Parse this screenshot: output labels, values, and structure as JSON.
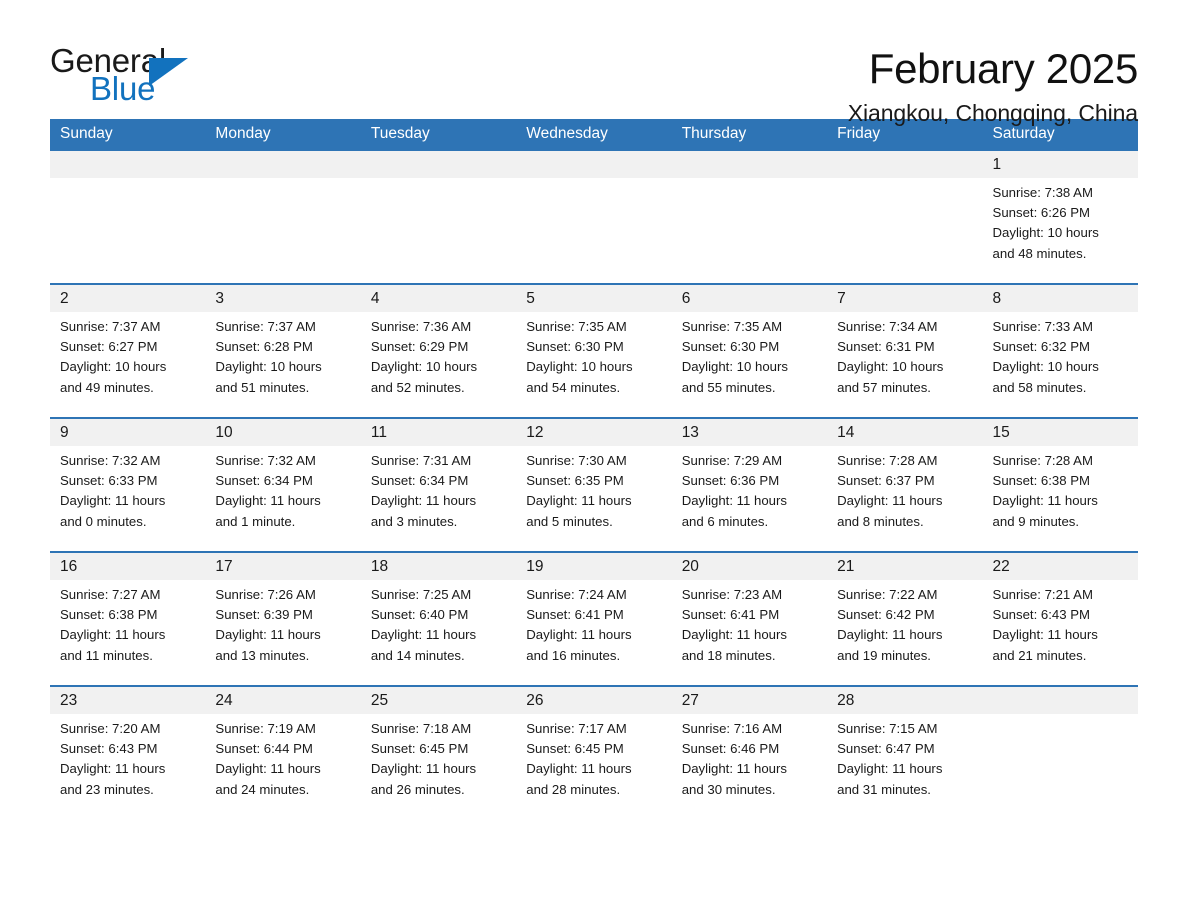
{
  "brand": {
    "word_one": "General",
    "word_two": "Blue",
    "triangle_icon": "triangle-icon",
    "accent_color": "#1272be"
  },
  "header": {
    "title": "February 2025",
    "location": "Xiangkou, Chongqing, China"
  },
  "calendar": {
    "header_color": "#2e74b5",
    "daynum_band_color": "#f1f1f1",
    "weekday_headers": [
      "Sunday",
      "Monday",
      "Tuesday",
      "Wednesday",
      "Thursday",
      "Friday",
      "Saturday"
    ],
    "weeks": [
      [
        {
          "day": "",
          "lines": []
        },
        {
          "day": "",
          "lines": []
        },
        {
          "day": "",
          "lines": []
        },
        {
          "day": "",
          "lines": []
        },
        {
          "day": "",
          "lines": []
        },
        {
          "day": "",
          "lines": []
        },
        {
          "day": "1",
          "lines": [
            "Sunrise: 7:38 AM",
            "Sunset: 6:26 PM",
            "Daylight: 10 hours",
            "and 48 minutes."
          ]
        }
      ],
      [
        {
          "day": "2",
          "lines": [
            "Sunrise: 7:37 AM",
            "Sunset: 6:27 PM",
            "Daylight: 10 hours",
            "and 49 minutes."
          ]
        },
        {
          "day": "3",
          "lines": [
            "Sunrise: 7:37 AM",
            "Sunset: 6:28 PM",
            "Daylight: 10 hours",
            "and 51 minutes."
          ]
        },
        {
          "day": "4",
          "lines": [
            "Sunrise: 7:36 AM",
            "Sunset: 6:29 PM",
            "Daylight: 10 hours",
            "and 52 minutes."
          ]
        },
        {
          "day": "5",
          "lines": [
            "Sunrise: 7:35 AM",
            "Sunset: 6:30 PM",
            "Daylight: 10 hours",
            "and 54 minutes."
          ]
        },
        {
          "day": "6",
          "lines": [
            "Sunrise: 7:35 AM",
            "Sunset: 6:30 PM",
            "Daylight: 10 hours",
            "and 55 minutes."
          ]
        },
        {
          "day": "7",
          "lines": [
            "Sunrise: 7:34 AM",
            "Sunset: 6:31 PM",
            "Daylight: 10 hours",
            "and 57 minutes."
          ]
        },
        {
          "day": "8",
          "lines": [
            "Sunrise: 7:33 AM",
            "Sunset: 6:32 PM",
            "Daylight: 10 hours",
            "and 58 minutes."
          ]
        }
      ],
      [
        {
          "day": "9",
          "lines": [
            "Sunrise: 7:32 AM",
            "Sunset: 6:33 PM",
            "Daylight: 11 hours",
            "and 0 minutes."
          ]
        },
        {
          "day": "10",
          "lines": [
            "Sunrise: 7:32 AM",
            "Sunset: 6:34 PM",
            "Daylight: 11 hours",
            "and 1 minute."
          ]
        },
        {
          "day": "11",
          "lines": [
            "Sunrise: 7:31 AM",
            "Sunset: 6:34 PM",
            "Daylight: 11 hours",
            "and 3 minutes."
          ]
        },
        {
          "day": "12",
          "lines": [
            "Sunrise: 7:30 AM",
            "Sunset: 6:35 PM",
            "Daylight: 11 hours",
            "and 5 minutes."
          ]
        },
        {
          "day": "13",
          "lines": [
            "Sunrise: 7:29 AM",
            "Sunset: 6:36 PM",
            "Daylight: 11 hours",
            "and 6 minutes."
          ]
        },
        {
          "day": "14",
          "lines": [
            "Sunrise: 7:28 AM",
            "Sunset: 6:37 PM",
            "Daylight: 11 hours",
            "and 8 minutes."
          ]
        },
        {
          "day": "15",
          "lines": [
            "Sunrise: 7:28 AM",
            "Sunset: 6:38 PM",
            "Daylight: 11 hours",
            "and 9 minutes."
          ]
        }
      ],
      [
        {
          "day": "16",
          "lines": [
            "Sunrise: 7:27 AM",
            "Sunset: 6:38 PM",
            "Daylight: 11 hours",
            "and 11 minutes."
          ]
        },
        {
          "day": "17",
          "lines": [
            "Sunrise: 7:26 AM",
            "Sunset: 6:39 PM",
            "Daylight: 11 hours",
            "and 13 minutes."
          ]
        },
        {
          "day": "18",
          "lines": [
            "Sunrise: 7:25 AM",
            "Sunset: 6:40 PM",
            "Daylight: 11 hours",
            "and 14 minutes."
          ]
        },
        {
          "day": "19",
          "lines": [
            "Sunrise: 7:24 AM",
            "Sunset: 6:41 PM",
            "Daylight: 11 hours",
            "and 16 minutes."
          ]
        },
        {
          "day": "20",
          "lines": [
            "Sunrise: 7:23 AM",
            "Sunset: 6:41 PM",
            "Daylight: 11 hours",
            "and 18 minutes."
          ]
        },
        {
          "day": "21",
          "lines": [
            "Sunrise: 7:22 AM",
            "Sunset: 6:42 PM",
            "Daylight: 11 hours",
            "and 19 minutes."
          ]
        },
        {
          "day": "22",
          "lines": [
            "Sunrise: 7:21 AM",
            "Sunset: 6:43 PM",
            "Daylight: 11 hours",
            "and 21 minutes."
          ]
        }
      ],
      [
        {
          "day": "23",
          "lines": [
            "Sunrise: 7:20 AM",
            "Sunset: 6:43 PM",
            "Daylight: 11 hours",
            "and 23 minutes."
          ]
        },
        {
          "day": "24",
          "lines": [
            "Sunrise: 7:19 AM",
            "Sunset: 6:44 PM",
            "Daylight: 11 hours",
            "and 24 minutes."
          ]
        },
        {
          "day": "25",
          "lines": [
            "Sunrise: 7:18 AM",
            "Sunset: 6:45 PM",
            "Daylight: 11 hours",
            "and 26 minutes."
          ]
        },
        {
          "day": "26",
          "lines": [
            "Sunrise: 7:17 AM",
            "Sunset: 6:45 PM",
            "Daylight: 11 hours",
            "and 28 minutes."
          ]
        },
        {
          "day": "27",
          "lines": [
            "Sunrise: 7:16 AM",
            "Sunset: 6:46 PM",
            "Daylight: 11 hours",
            "and 30 minutes."
          ]
        },
        {
          "day": "28",
          "lines": [
            "Sunrise: 7:15 AM",
            "Sunset: 6:47 PM",
            "Daylight: 11 hours",
            "and 31 minutes."
          ]
        },
        {
          "day": "",
          "lines": []
        }
      ]
    ]
  }
}
